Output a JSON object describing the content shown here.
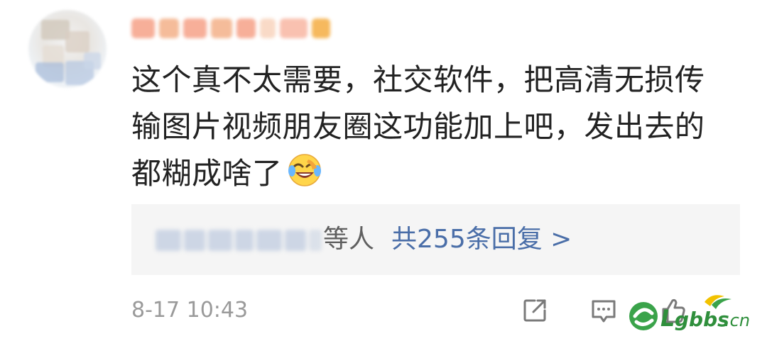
{
  "comment": {
    "lines": [
      "这个真不太需要，社交软件，把高清无损传",
      "输图片视频朋友圈这功能加上吧，发出去的",
      "都糊成啥了"
    ],
    "emoji": "laughing-crying-emoji"
  },
  "replies": {
    "suffix": "等人",
    "link": "共255条回复 >"
  },
  "meta": {
    "timestamp": "8-17 10:43"
  },
  "actions": {
    "share_icon": "share-icon",
    "comment_icon": "comment-icon",
    "like_icon": "thumbs-up-icon"
  },
  "watermark": {
    "text": "Lgbbs.cn"
  },
  "colors": {
    "text": "#222222",
    "muted": "#9a9a9a",
    "link": "#4a6ea8",
    "reply_bg": "#f5f5f5"
  }
}
